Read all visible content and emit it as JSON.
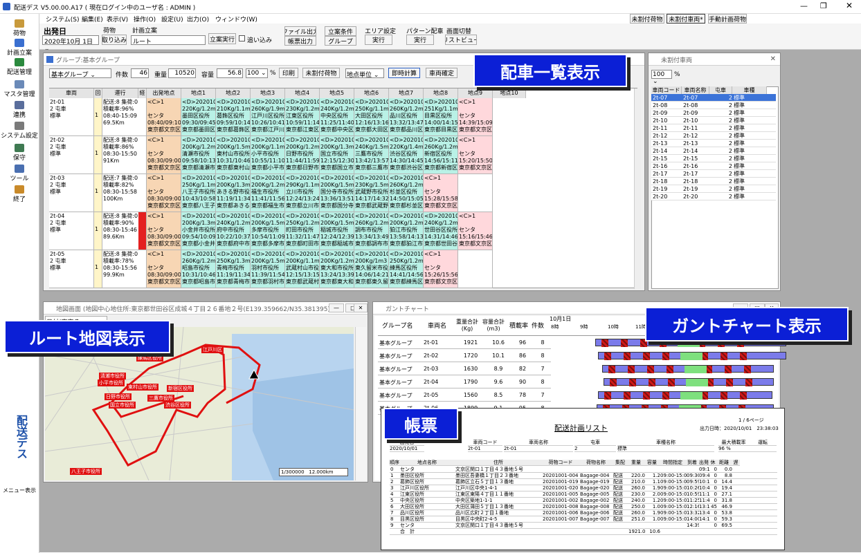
{
  "app": {
    "title": "配送デス V5.00.00.A17 ( 現在ログイン中のユーザ名 : ADMIN )",
    "menu": [
      "システム(S)",
      "編集(E)",
      "表示(V)",
      "操作(O)",
      "設定(U)",
      "出力(O)",
      "ウィンドウ(W)"
    ],
    "right_buttons": [
      "未割付荷物",
      "未割付車両*",
      "手動計画荷物"
    ],
    "side_bottom": "メニュー表示",
    "logo": "配送デス"
  },
  "sidebar": [
    "荷物",
    "計画立案",
    "配送管理",
    "マスタ管理",
    "連携",
    "システム設定",
    "保守",
    "ツール",
    "終了"
  ],
  "toolbar": {
    "date_label": "出発日",
    "date_value": "2020年10月 1日",
    "cargo_label": "荷物",
    "cargo_btn": "取り込み",
    "plan_label": "計画立案",
    "plan_value": "ルート",
    "run_btn": "立案実行",
    "append_label": "追い込み",
    "file_out": "ファイル出力",
    "report_out": "帳票出力",
    "cond_label": "立案条件",
    "group_btn": "グループ",
    "area_label": "エリア設定",
    "area_run": "実行",
    "pattern_label": "パターン配車",
    "pattern_run": "実行",
    "screen_label": "画面切替",
    "preview_btn": "リストビュー"
  },
  "group_win": {
    "title": "グループ:基本グループ",
    "group_select": "基本グループ",
    "count_label": "件数",
    "count": "46",
    "weight_label": "重量",
    "weight": "10520",
    "volume_label": "容量",
    "volume": "56.8",
    "ratio": "100",
    "pct": "%",
    "print_btn": "印刷",
    "unassigned_btn": "未割付荷物",
    "unit_select": "地点単位",
    "calc_btn": "即時計算",
    "confirm_btn": "車両確定",
    "headers": [
      "車両",
      "回転",
      "運行",
      "経路",
      "出発地点",
      "地点1",
      "地点2",
      "地点3",
      "地点4",
      "地点5",
      "地点6",
      "地点7",
      "地点8",
      "地点9",
      "地点10"
    ],
    "rows": [
      {
        "vehicle": "2t-01\n2 屯車\n標準",
        "rot": "1",
        "op": "配送:8 集荷:0\n積載率:96%\n08:40-15:09\n69.5Km",
        "cells": [
          "<C>1\n\nセンタ\n08:40/09:10\n東京都文京区関口",
          "<D>20201001-\n220Kg/1.2m3\n墨田区役所\n09:30/09:45\n東京都墨田区吾妻",
          "<D>20201001-\n210Kg/1.1m3\n葛飾区役所\n09:59/10:14\n東京都葛飾区立石",
          "<D>20201001-\n260Kg/1.9m3\n江戸川区役所\n10:26/10:41\n東京都江戸川区中",
          "<D>20201001-\n230Kg/1.2m3\n江東区役所\n10:59/11:14\n東京都江東区東陽",
          "<D>20201001-\n240Kg/1.2m3\n中央区役所\n11:25/11:40\n東京都中央区築地",
          "<D>20201001-\n250Kg/1.1m3\n大田区役所\n12:16/13:16\n東京都大田区蒲田",
          "<D>20201001-\n260Kg/1.2m3\n品川区役所\n13:32/13:47\n東京都品川区広町",
          "<D>20201001-\n251Kg/1.1m3\n目黒区役所\n14:00/14:15\n東京都目黒区中央",
          "<C>1\n\nセンタ\n14:39/15:09\n東京都文京区関口"
        ]
      },
      {
        "vehicle": "2t-02\n2 屯車\n標準",
        "rot": "1",
        "op": "配送:8 集荷:0\n積載率:86%\n08:30-15:50\n91Km",
        "cells": [
          "<C>1\n\nセンタ\n08:30/09:00\n東京都文京区関口",
          "<D>20201001-\n200Kg/1.2m3\n清瀬市役所\n09:58/10:13\n東京都清瀬市中里",
          "<D>20201001-\n200Kg/1.5m3\n東村山市役所\n10:31/10:46\n東京都東村山市本",
          "<D>20201001-\n200Kg/1.1m3\n小平市役所\n10:55/11:10\n東京都小平市小川",
          "<D>20201001-\n200Kg/1.2m3\n日野市役所\n11:44/11:59\n東京都日野市神明",
          "<D>20201001-\n200Kg/1.3m3\n国立市役所\n12:15/12:30\n東京都国立市富士",
          "<D>20201001-\n240Kg/1.5m3\n三鷹市役所\n13:42/13:57\n東京都三鷹市野崎",
          "<D>20201001-\n220Kg/1.4m3\n渋谷区役所\n14:30/14:45\n東京都渋谷区宇田",
          "<D>20201001-\n260Kg/1.2m3\n新宿区役所\n14:56/15:11\n東京都新宿区歌舞",
          "<C>1\n\nセンタ\n15:20/15:50\n東京都文京区関口"
        ]
      },
      {
        "vehicle": "2t-03\n2 屯車\n標準",
        "rot": "1",
        "op": "配送:7 集荷:0\n積載率:82%\n08:30-15:58\n100Km",
        "cells": [
          "<C>1\n\nセンタ\n08:30/09:00\n東京都文京区関口",
          "<D>20201001-\n250Kg/1.1m3\n八王子市役所\n10:43/10:58\n東京都八王子市元",
          "<D>20201001-\n200Kg/1.3m3\nあきる野市役所\n11:19/11:34\n東京都あきる野市",
          "<D>20201001-\n200Kg/1.2m3\n福生市役所\n11:41/11:56\n東京都福生市本町",
          "<D>20201001-\n290Kg/1.1m3\n立川市役所\n12:24/13:24\n東京都立川市錦町",
          "<D>20201001-\n200Kg/1.5m3\n国分寺市役所\n13:36/13:51\n東京都国分寺市戸",
          "<D>20201001-\n230Kg/1.5m3\n武蔵野市役所\n14:17/14:32\n東京都武蔵野市緑",
          "<D>20201001-\n260Kg/1.2m3\n杉並区役所\n14:50/15:05\n東京都杉並区阿佐",
          "<C>1\n\nセンタ\n15:28/15:58\n東京都文京区関口",
          ""
        ]
      },
      {
        "vehicle": "2t-04\n2 屯車\n標準",
        "rot": "1",
        "op": "配送:8 集荷:0\n積載率:90%\n08:30-15:46\n89.6Km",
        "cells": [
          "<C>1\n\nセンタ\n08:30/09:00\n東京都文京区関口",
          "<D>20201001-\n200Kg/1.3m3\n小金井市役所\n09:54/10:09\n東京都小金井市本",
          "<D>20201001-\n240Kg/1.2m3\n府中市役所\n10:22/10:37\n東京都府中市宮西",
          "<D>20201001-\n200Kg/1.5m3\n多摩市役所\n10:54/11:09\n東京都多摩市関戸",
          "<D>20201001-\n250Kg/1.2m3\n町田市役所\n11:32/11:47\n東京都町田市中町",
          "<D>20201001-\n200Kg/1.5m3\n稲城市役所\n12:24/12:39\n東京都稲城市東長",
          "<D>20201001-\n260Kg/1.2m3\n調布市役所\n13:34/13:49\n東京都調布市小島",
          "<D>20201001-\n200Kg/1.2m3\n狛江市役所\n13:58/14:13\n東京都狛江市和泉",
          "<D>20201001-\n240Kg/1.2m3\n世田谷区役所\n14:31/14:46\n東京都世田谷区世",
          "<C>1\n\nセンタ\n15:16/15:46\n東京都文京区関口"
        ]
      },
      {
        "vehicle": "2t-05\n2 屯車\n標準",
        "rot": "1",
        "op": "配送:8 集荷:0\n積載率:78%\n08:30-15:56\n99.9Km",
        "cells": [
          "<C>1\n\nセンタ\n08:30/09:00\n東京都文京区関口",
          "<D>20201001-\n260Kg/1.2m3\n昭島市役所\n10:31/10:46\n東京都昭島市田中",
          "<D>20201001-\n250Kg/1.3m3\n青梅市役所\n11:19/11:34\n東京都青梅市東青",
          "<D>20201001-\n200Kg/1.5m3\n羽村市役所\n11:39/11:54\n東京都羽村市緑ケ",
          "<D>20201001-\n200Kg/1.1m3\n武蔵村山市役所\n12:15/13:15\n東京都武蔵村山市",
          "<D>20201001-\n200Kg/1.2m3\n東大和市役所\n13:24/13:39\n東京都東大和市中",
          "<D>20201001-\n200Kg/1m3\n東久留米市役所\n14:06/14:21\n東京都東久留米市",
          "<D>20201001-\n250Kg/1.2m3\n練馬区役所\n14:41/14:56\n東京都練馬区豊玉",
          "<C>1\n\nセンタ\n15:26/15:56\n東京都文京区関口",
          ""
        ]
      }
    ]
  },
  "vehicle_win": {
    "title": "未割付車両",
    "ratio": "100",
    "pct": "%",
    "headers": [
      "車両コード",
      "車両名称",
      "屯車",
      "車種"
    ],
    "rows": [
      [
        "2t-07",
        "2t-07",
        "2",
        "標準"
      ],
      [
        "2t-08",
        "2t-08",
        "2",
        "標準"
      ],
      [
        "2t-09",
        "2t-09",
        "2",
        "標準"
      ],
      [
        "2t-10",
        "2t-10",
        "2",
        "標準"
      ],
      [
        "2t-11",
        "2t-11",
        "2",
        "標準"
      ],
      [
        "2t-12",
        "2t-12",
        "2",
        "標準"
      ],
      [
        "2t-13",
        "2t-13",
        "2",
        "標準"
      ],
      [
        "2t-14",
        "2t-14",
        "2",
        "標準"
      ],
      [
        "2t-15",
        "2t-15",
        "2",
        "標準"
      ],
      [
        "2t-16",
        "2t-16",
        "2",
        "標準"
      ],
      [
        "2t-17",
        "2t-17",
        "2",
        "標準"
      ],
      [
        "2t-18",
        "2t-18",
        "2",
        "標準"
      ],
      [
        "2t-19",
        "2t-19",
        "2",
        "標準"
      ],
      [
        "2t-20",
        "2t-20",
        "2",
        "標準"
      ]
    ]
  },
  "map_win": {
    "title": "地図画面 (地図中心地住所:東京都世田谷区成城４丁目２６番地２号(E139.359662/N35.381395))",
    "scale": "1/300000",
    "distance": "12.000km",
    "tab": "日付(東京ろ",
    "labels": [
      "練馬区役所",
      "清瀬市役所",
      "小平市役所",
      "東村山市役所",
      "日野市役所",
      "国立市役所",
      "三鷹市役所",
      "渋谷区役所",
      "新宿区役所",
      "八王子市役所",
      "江戸川区"
    ]
  },
  "gantt_win": {
    "title": "ガントチャート",
    "headers": [
      "グループ名",
      "車両名",
      "重量合計(Kg)",
      "容量合計(m3)",
      "積載率",
      "件数"
    ],
    "date": "10月1日",
    "hours": [
      "8時",
      "9時",
      "10時",
      "11時"
    ],
    "rows": [
      [
        "基本グループ",
        "2t-01",
        "1921",
        "10.6",
        "96",
        "8"
      ],
      [
        "基本グループ",
        "2t-02",
        "1720",
        "10.1",
        "86",
        "8"
      ],
      [
        "基本グループ",
        "2t-03",
        "1630",
        "8.9",
        "82",
        "7"
      ],
      [
        "基本グループ",
        "2t-04",
        "1790",
        "9.6",
        "90",
        "8"
      ],
      [
        "基本グループ",
        "2t-05",
        "1560",
        "8.5",
        "78",
        "7"
      ],
      [
        "基本グループ",
        "2t-06",
        "1899",
        "9.1",
        "95",
        "8"
      ]
    ]
  },
  "report": {
    "title": "配送計画リスト",
    "page": "1 / 6ページ",
    "printed": "出力日時：2020/10/01　23:38:03",
    "info_headers": [
      "出発日",
      "車両コード",
      "車両名称",
      "屯車",
      "車種名称",
      "最大積載率",
      "運転"
    ],
    "info_values": [
      "2020/10/01",
      "2t-01",
      "2t-01",
      "2",
      "標準",
      "96 %",
      ""
    ],
    "headers": [
      "順序",
      "地点名称",
      "住所",
      "荷物コード",
      "荷物名称",
      "集配",
      "重量",
      "容量",
      "時間指定",
      "到着",
      "出発",
      "休",
      "距離",
      "遅"
    ],
    "rows": [
      [
        "0",
        "センタ",
        "文京区関口１丁目４３番地５号",
        "",
        "",
        "",
        "",
        "",
        "",
        "",
        "09:10",
        "0",
        "0.0",
        ""
      ],
      [
        "1",
        "墨田区役所",
        "墨田区吾妻橋１丁目２３番地",
        "20201001-004",
        "Bagage-004",
        "配送",
        "220.0",
        "1.2",
        "09:00-15:00",
        "09:30",
        "09:45",
        "0",
        "8.8",
        ""
      ],
      [
        "2",
        "葛飾区役所",
        "葛飾区立石５丁目１３番地",
        "20201001-019",
        "Bagage-019",
        "配送",
        "210.0",
        "1.1",
        "09:00-15:00",
        "09:59",
        "10:14",
        "0",
        "14.4",
        ""
      ],
      [
        "3",
        "江戸川区役所",
        "江戸川区中央1-4-1",
        "20201001-020",
        "Bagage-020",
        "配送",
        "260.0",
        "1.9",
        "09:00-15:00",
        "10:26",
        "10:41",
        "0",
        "19.4",
        ""
      ],
      [
        "4",
        "江東区役所",
        "江東区東陽４丁目１１番地",
        "20201001-005",
        "Bagage-005",
        "配送",
        "230.0",
        "2.0",
        "09:00-15:00",
        "10:59",
        "11:14",
        "0",
        "27.1",
        ""
      ],
      [
        "5",
        "中央区役所",
        "中央区築地1-1-1",
        "20201001-002",
        "Bagage-002",
        "配送",
        "240.0",
        "1.2",
        "09:00-15:00",
        "11:25",
        "11:40",
        "0",
        "31.8",
        ""
      ],
      [
        "6",
        "大田区役所",
        "大田区蒲田５丁目１３番地",
        "20201001-008",
        "Bagage-008",
        "配送",
        "250.0",
        "1.0",
        "09:00-15:00",
        "12:16",
        "13:16",
        "45",
        "46.9",
        ""
      ],
      [
        "7",
        "品川区役所",
        "品川区広町２丁目１番地",
        "20201001-006",
        "Bagage-006",
        "配送",
        "260.0",
        "1.9",
        "09:00-15:00",
        "13:32",
        "13:47",
        "0",
        "53.8",
        ""
      ],
      [
        "8",
        "目黒区役所",
        "目黒区中央町2-4-5",
        "20201001-007",
        "Bagage-007",
        "配送",
        "251.0",
        "1.0",
        "09:00-15:00",
        "14:00",
        "14:15",
        "0",
        "59.3",
        ""
      ],
      [
        "9",
        "センタ",
        "文京区関口１丁目４３番地５号",
        "",
        "",
        "",
        "",
        "",
        "",
        "14:39",
        "",
        "0",
        "69.5",
        ""
      ],
      [
        "",
        "合　計",
        "",
        "",
        "",
        "",
        "1921.0",
        "10.6",
        "",
        "",
        "",
        "",
        "",
        ""
      ]
    ]
  },
  "callouts": {
    "dispatch": "配車一覧表示",
    "map": "ルート地図表示",
    "gantt": "ガントチャート表示",
    "report": "帳票"
  }
}
